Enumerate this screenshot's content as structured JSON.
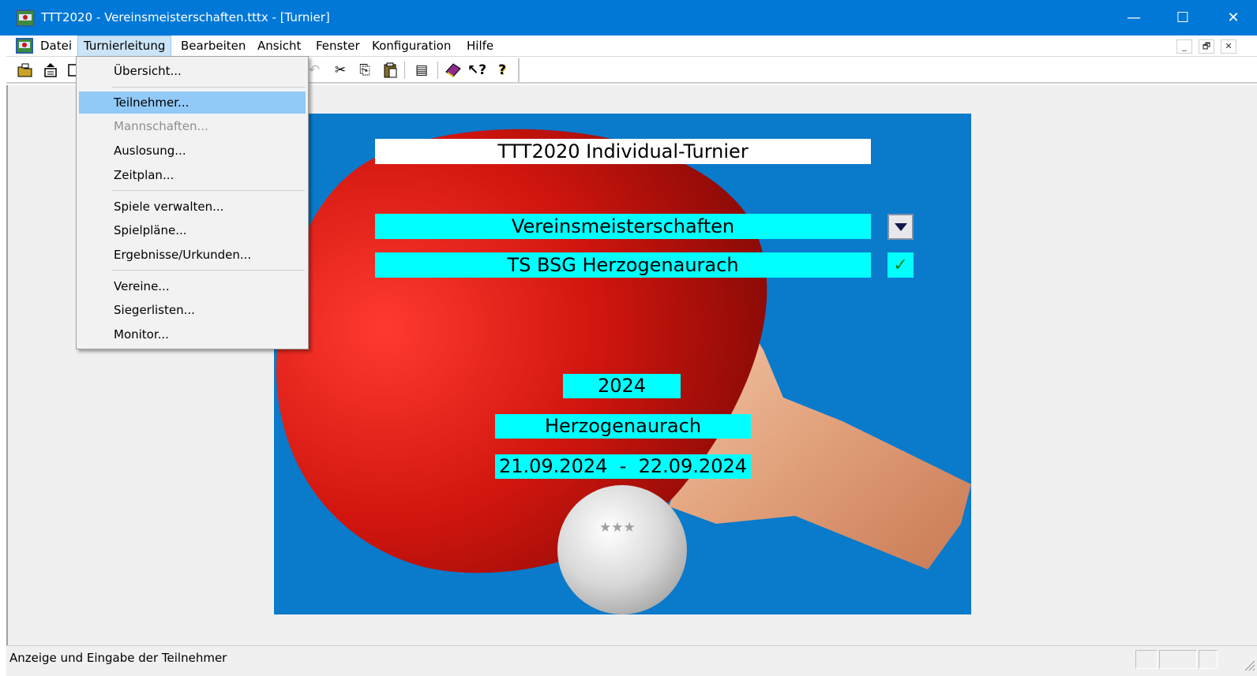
{
  "window": {
    "title": "TTT2020 - Vereinsmeisterschaften.tttx - [Turnier]",
    "controls": {
      "minimize": "—",
      "maximize": "☐",
      "close": "✕"
    }
  },
  "menubar": {
    "items": [
      "Datei",
      "Turnierleitung",
      "Bearbeiten",
      "Ansicht",
      "Fenster",
      "Konfiguration",
      "Hilfe"
    ],
    "active": "Turnierleitung",
    "mdi_controls": {
      "minimize": "_",
      "restore": "🗗",
      "close": "✕"
    }
  },
  "toolbar": {
    "icons": [
      "open-folder-icon",
      "new-icon",
      "save-icon",
      "undo-icon",
      "cut-icon",
      "copy-icon",
      "paste-icon",
      "list-icon",
      "book-icon",
      "context-help-icon",
      "help-icon"
    ],
    "glyphs": {
      "cut": "✂",
      "copy": "⎘",
      "paste": "📋",
      "list": "▤",
      "book": "📕",
      "context_help": "↖?",
      "help": "?"
    }
  },
  "dropdown": {
    "items": [
      {
        "label": "Übersicht...",
        "state": "normal"
      },
      {
        "label": "Teilnehmer...",
        "state": "highlighted"
      },
      {
        "label": "Mannschaften...",
        "state": "disabled"
      },
      {
        "label": "Auslosung...",
        "state": "normal"
      },
      {
        "label": "Zeitplan...",
        "state": "normal"
      },
      {
        "label": "Spiele verwalten...",
        "state": "normal"
      },
      {
        "label": "Spielpläne...",
        "state": "normal"
      },
      {
        "label": "Ergebnisse/Urkunden...",
        "state": "normal"
      },
      {
        "label": "Vereine...",
        "state": "normal"
      },
      {
        "label": "Siegerlisten...",
        "state": "normal"
      },
      {
        "label": "Monitor...",
        "state": "normal"
      }
    ]
  },
  "tournament": {
    "type_label": "TTT2020 Individual-Turnier",
    "name": "Vereinsmeisterschaften",
    "club": "TS BSG Herzogenaurach",
    "year": "2024",
    "location": "Herzogenaurach",
    "date_from": "21.09.2024",
    "date_sep": "-",
    "date_to": "22.09.2024",
    "checkmark": "✓",
    "ball_stars": "★★★"
  },
  "colors": {
    "titlebar": "#0078d7",
    "panel": "#0a7acb",
    "field": "#00ffff",
    "highlight": "#91c9f7",
    "paddle_red": "#c81812",
    "handle": "#e8a880"
  },
  "statusbar": {
    "text": "Anzeige und Eingabe der Teilnehmer"
  }
}
